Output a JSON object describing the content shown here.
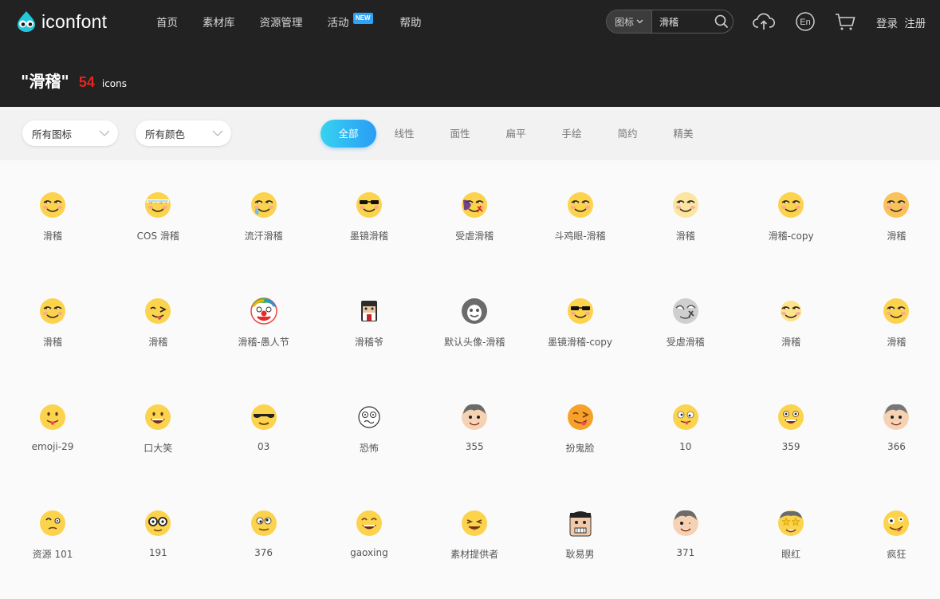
{
  "header": {
    "logo_text": "iconfont",
    "nav": [
      {
        "label": "首页"
      },
      {
        "label": "素材库"
      },
      {
        "label": "资源管理"
      },
      {
        "label": "活动",
        "badge": "NEW"
      },
      {
        "label": "帮助"
      }
    ],
    "search": {
      "type_label": "图标",
      "value": "滑稽"
    },
    "icons": [
      "upload-icon",
      "language-en-icon",
      "cart-icon"
    ],
    "lang_label": "En",
    "login_label": "登录",
    "register_label": "注册"
  },
  "result": {
    "query": "\"滑稽\"",
    "count": "54",
    "unit": "icons"
  },
  "filters": {
    "icon_select": "所有图标",
    "color_select": "所有颜色"
  },
  "tabs": [
    "全部",
    "线性",
    "面性",
    "扁平",
    "手绘",
    "简约",
    "精美"
  ],
  "active_tab": "全部",
  "colors": {
    "accent_start": "#37d3f0",
    "accent_end": "#2a9cf5",
    "count_red": "#e8251b",
    "header_bg": "#222222"
  },
  "icons": [
    {
      "label": "滑稽",
      "style": "huaji"
    },
    {
      "label": "COS 滑稽",
      "style": "huaji-bandage"
    },
    {
      "label": "流汗滑稽",
      "style": "huaji-sweat"
    },
    {
      "label": "墨镜滑稽",
      "style": "huaji-sunglasses"
    },
    {
      "label": "受虐滑稽",
      "style": "huaji-hurt"
    },
    {
      "label": "斗鸡眼-滑稽",
      "style": "huaji"
    },
    {
      "label": "滑稽",
      "style": "huaji-pale"
    },
    {
      "label": "滑稽-copy",
      "style": "huaji"
    },
    {
      "label": "滑稽",
      "style": "huaji-orange"
    },
    {
      "label": "滑稽",
      "style": "huaji"
    },
    {
      "label": "滑稽",
      "style": "wink-tongue"
    },
    {
      "label": "滑稽-愚人节",
      "style": "clown"
    },
    {
      "label": "滑稽爷",
      "style": "grandpa"
    },
    {
      "label": "默认头像-滑稽",
      "style": "gray-avatar"
    },
    {
      "label": "墨镜滑稽-copy",
      "style": "huaji-sunglasses"
    },
    {
      "label": "受虐滑稽",
      "style": "gray-hurt"
    },
    {
      "label": "滑稽",
      "style": "huaji-small"
    },
    {
      "label": "滑稽",
      "style": "huaji-bright"
    },
    {
      "label": "emoji-29",
      "style": "tongue-out"
    },
    {
      "label": "口大笑",
      "style": "laugh"
    },
    {
      "label": "03",
      "style": "cool"
    },
    {
      "label": "恐怖",
      "style": "scared-outline"
    },
    {
      "label": "355",
      "style": "boy"
    },
    {
      "label": "扮鬼脸",
      "style": "face-pull"
    },
    {
      "label": "10",
      "style": "crazy-tongue"
    },
    {
      "label": "359",
      "style": "grin-big"
    },
    {
      "label": "366",
      "style": "boy-gray"
    },
    {
      "label": "资源 101",
      "style": "dizzy"
    },
    {
      "label": "191",
      "style": "glasses"
    },
    {
      "label": "376",
      "style": "googly"
    },
    {
      "label": "gaoxing",
      "style": "happy"
    },
    {
      "label": "素材提供者",
      "style": "squint-tongue"
    },
    {
      "label": "耿易男",
      "style": "square-man"
    },
    {
      "label": "371",
      "style": "boy-wink"
    },
    {
      "label": "眼红",
      "style": "star-eyes"
    },
    {
      "label": "疯狂",
      "style": "crazy"
    }
  ]
}
